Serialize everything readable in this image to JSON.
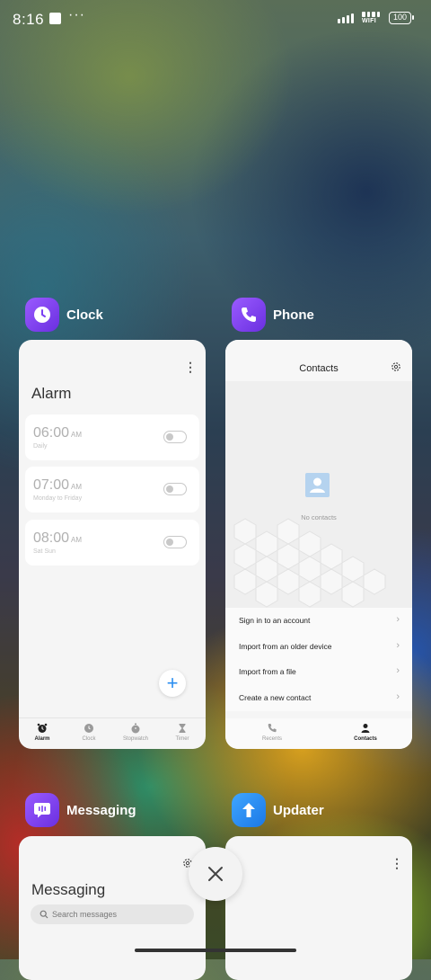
{
  "status_bar": {
    "time": "8:16",
    "dots": "···",
    "network": "WIFI",
    "battery": "100"
  },
  "apps": [
    {
      "name": "Clock",
      "color": "#7b3ff2"
    },
    {
      "name": "Phone",
      "color": "#7b3ff2"
    },
    {
      "name": "Messaging",
      "color": "#7b3ff2"
    },
    {
      "name": "Updater",
      "color": "#2a8ef0"
    }
  ],
  "clock": {
    "menu": "⋮",
    "title": "Alarm",
    "alarms": [
      {
        "time": "06:00",
        "ampm": "AM",
        "repeat": "Daily",
        "enabled": false
      },
      {
        "time": "07:00",
        "ampm": "AM",
        "repeat": "Monday to Friday",
        "enabled": false
      },
      {
        "time": "08:00",
        "ampm": "AM",
        "repeat": "Sat Sun",
        "enabled": false
      }
    ],
    "fab": "+",
    "tabs": [
      {
        "label": "Alarm",
        "active": true
      },
      {
        "label": "Clock",
        "active": false
      },
      {
        "label": "Stopwatch",
        "active": false
      },
      {
        "label": "Timer",
        "active": false
      }
    ]
  },
  "phone": {
    "title": "Contacts",
    "empty_text": "No contacts",
    "options": [
      {
        "label": "Sign in to an account",
        "chevron": "›"
      },
      {
        "label": "Import from an older device",
        "chevron": "›"
      },
      {
        "label": "Import from a file",
        "chevron": "›"
      },
      {
        "label": "Create a new contact",
        "chevron": "›"
      }
    ],
    "tabs": [
      {
        "label": "Recents",
        "active": false
      },
      {
        "label": "Contacts",
        "active": true
      }
    ]
  },
  "messaging": {
    "title": "Messaging",
    "search_placeholder": "Search messages"
  },
  "updater": {
    "menu": "⋮"
  }
}
